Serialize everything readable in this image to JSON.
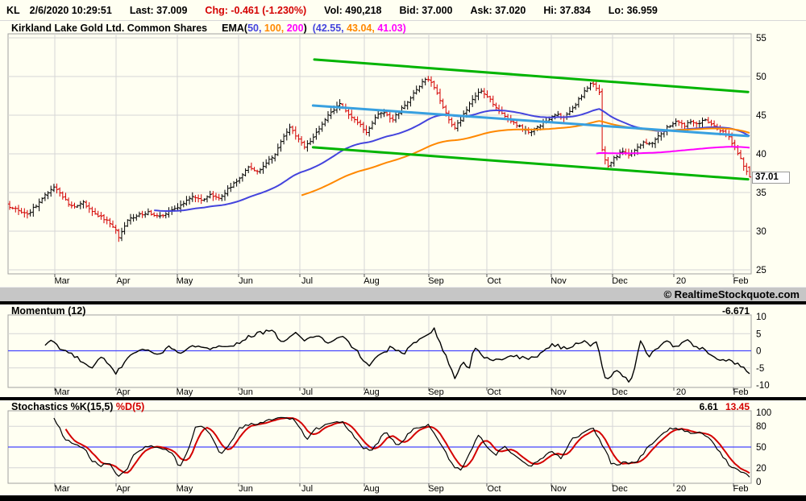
{
  "header": {
    "symbol": "KL",
    "datetime": "2/6/2020 10:29:51",
    "last": "Last: 37.009",
    "chg": "Chg: -0.461 (-1.230%)",
    "vol": "Vol: 490,218",
    "bid": "Bid: 37.000",
    "ask": "Ask: 37.020",
    "hi": "Hi: 37.834",
    "lo": "Lo: 36.959"
  },
  "watermark": "© RealtimeStockquote.com",
  "colors": {
    "up_bar": "#000000",
    "down_bar": "#d40000",
    "ema50": "#4444dd",
    "ema100": "#ff8800",
    "ema200": "#ff00ff",
    "trend_green": "#00b400",
    "trend_cyan": "#38a0e0",
    "mid_blue": "#4444ff",
    "grid": "#d6d6d6",
    "box": "#a0a0a0",
    "bg": "#fffff2"
  },
  "months": [
    {
      "label": "Mar",
      "frac": 0.061
    },
    {
      "label": "Apr",
      "frac": 0.1438
    },
    {
      "label": "May",
      "frac": 0.2266
    },
    {
      "label": "Jun",
      "frac": 0.3094
    },
    {
      "label": "Jul",
      "frac": 0.3922
    },
    {
      "label": "Aug",
      "frac": 0.4793
    },
    {
      "label": "Sep",
      "frac": 0.5664
    },
    {
      "label": "Oct",
      "frac": 0.6449
    },
    {
      "label": "Nov",
      "frac": 0.732
    },
    {
      "label": "Dec",
      "frac": 0.8148
    },
    {
      "label": "20",
      "frac": 0.8976
    },
    {
      "label": "Feb",
      "frac": 0.9782
    }
  ],
  "chart_data": [
    {
      "type": "bar",
      "subtype": "ohlc-daily",
      "title": "Kirkland Lake Gold Ltd. Common Shares",
      "legend": {
        "label": "EMA",
        "periods": [
          "50",
          "100",
          "200"
        ],
        "values": [
          "42.55",
          "43.04",
          "41.03"
        ],
        "colors": [
          "#4444dd",
          "#ff8800",
          "#ff00ff"
        ]
      },
      "ylim": [
        25,
        55
      ],
      "yticks": [
        "55",
        "50",
        "45",
        "40",
        "35",
        "30",
        "25"
      ],
      "last_price_label": "37.01",
      "bars": 252,
      "close_anchors": [
        [
          0.0,
          33.2
        ],
        [
          0.013,
          32.6
        ],
        [
          0.024,
          32.1
        ],
        [
          0.038,
          33.6
        ],
        [
          0.052,
          35.0
        ],
        [
          0.06,
          35.8
        ],
        [
          0.072,
          34.3
        ],
        [
          0.085,
          33.1
        ],
        [
          0.1,
          33.7
        ],
        [
          0.114,
          32.3
        ],
        [
          0.13,
          31.5
        ],
        [
          0.143,
          30.2
        ],
        [
          0.148,
          29.2
        ],
        [
          0.158,
          31.3
        ],
        [
          0.172,
          32.1
        ],
        [
          0.188,
          32.4
        ],
        [
          0.203,
          31.9
        ],
        [
          0.217,
          32.7
        ],
        [
          0.233,
          33.3
        ],
        [
          0.247,
          34.6
        ],
        [
          0.258,
          33.9
        ],
        [
          0.271,
          34.8
        ],
        [
          0.282,
          34.1
        ],
        [
          0.296,
          35.5
        ],
        [
          0.31,
          36.9
        ],
        [
          0.324,
          38.3
        ],
        [
          0.334,
          37.6
        ],
        [
          0.348,
          38.9
        ],
        [
          0.358,
          39.9
        ],
        [
          0.368,
          41.9
        ],
        [
          0.379,
          43.4
        ],
        [
          0.388,
          42.1
        ],
        [
          0.398,
          40.9
        ],
        [
          0.407,
          41.7
        ],
        [
          0.417,
          43.1
        ],
        [
          0.428,
          44.7
        ],
        [
          0.44,
          45.9
        ],
        [
          0.447,
          46.5
        ],
        [
          0.458,
          45.1
        ],
        [
          0.47,
          44.2
        ],
        [
          0.483,
          42.6
        ],
        [
          0.493,
          44.7
        ],
        [
          0.504,
          45.4
        ],
        [
          0.517,
          44.4
        ],
        [
          0.528,
          45.7
        ],
        [
          0.54,
          47.0
        ],
        [
          0.551,
          48.5
        ],
        [
          0.562,
          49.8
        ],
        [
          0.573,
          48.8
        ],
        [
          0.584,
          46.4
        ],
        [
          0.596,
          44.0
        ],
        [
          0.602,
          43.3
        ],
        [
          0.613,
          45.0
        ],
        [
          0.624,
          46.9
        ],
        [
          0.635,
          48.2
        ],
        [
          0.646,
          47.3
        ],
        [
          0.657,
          46.1
        ],
        [
          0.668,
          45.0
        ],
        [
          0.679,
          44.2
        ],
        [
          0.692,
          43.3
        ],
        [
          0.704,
          42.8
        ],
        [
          0.715,
          43.6
        ],
        [
          0.727,
          44.4
        ],
        [
          0.738,
          45.1
        ],
        [
          0.748,
          44.7
        ],
        [
          0.758,
          45.5
        ],
        [
          0.767,
          46.7
        ],
        [
          0.776,
          48.0
        ],
        [
          0.786,
          49.3
        ],
        [
          0.793,
          48.4
        ],
        [
          0.797,
          48.0
        ],
        [
          0.801,
          40.0
        ],
        [
          0.808,
          38.4
        ],
        [
          0.816,
          39.4
        ],
        [
          0.827,
          40.3
        ],
        [
          0.838,
          39.7
        ],
        [
          0.847,
          40.8
        ],
        [
          0.857,
          41.6
        ],
        [
          0.868,
          41.2
        ],
        [
          0.879,
          42.5
        ],
        [
          0.89,
          43.5
        ],
        [
          0.901,
          44.2
        ],
        [
          0.912,
          43.6
        ],
        [
          0.92,
          44.3
        ],
        [
          0.929,
          43.8
        ],
        [
          0.939,
          44.6
        ],
        [
          0.948,
          43.9
        ],
        [
          0.956,
          43.2
        ],
        [
          0.964,
          42.8
        ],
        [
          0.972,
          42.1
        ],
        [
          0.979,
          41.0
        ],
        [
          0.986,
          39.7
        ],
        [
          0.992,
          38.5
        ],
        [
          1.0,
          37.01
        ]
      ],
      "last_bar": {
        "open": 38.25,
        "high": 38.4,
        "low": 36.959,
        "close": 37.009
      },
      "trendlines": [
        {
          "pts": [
            [
              0.4118,
              52.2
            ],
            [
              0.998,
              48.0
            ]
          ],
          "color": "#00b400",
          "width": 3
        },
        {
          "pts": [
            [
              0.41,
              40.85
            ],
            [
              0.998,
              36.7
            ]
          ],
          "color": "#00b400",
          "width": 3
        },
        {
          "pts": [
            [
              0.41,
              46.25
            ],
            [
              0.998,
              42.3
            ]
          ],
          "color": "#38a0e0",
          "width": 3
        }
      ]
    },
    {
      "type": "line",
      "title": "Momentum (12)",
      "last_value": "-6.671",
      "ylim": [
        -10,
        10
      ],
      "yticks": [
        "10",
        "5",
        "0",
        "-5",
        "-10"
      ],
      "zero_line": 0,
      "start_index": 12,
      "anchors": [
        [
          0.041,
          -0.3
        ],
        [
          0.055,
          3.3
        ],
        [
          0.068,
          0.8
        ],
        [
          0.088,
          -1.6
        ],
        [
          0.111,
          -5.4
        ],
        [
          0.124,
          -1.8
        ],
        [
          0.144,
          -6.6
        ],
        [
          0.162,
          -1.2
        ],
        [
          0.178,
          0.6
        ],
        [
          0.198,
          -1.2
        ],
        [
          0.218,
          1.2
        ],
        [
          0.233,
          -0.9
        ],
        [
          0.25,
          1.6
        ],
        [
          0.266,
          0.2
        ],
        [
          0.283,
          1.9
        ],
        [
          0.3,
          1.0
        ],
        [
          0.318,
          3.7
        ],
        [
          0.335,
          5.0
        ],
        [
          0.354,
          5.8
        ],
        [
          0.37,
          2.4
        ],
        [
          0.384,
          5.2
        ],
        [
          0.4,
          3.1
        ],
        [
          0.415,
          4.6
        ],
        [
          0.431,
          2.0
        ],
        [
          0.449,
          4.2
        ],
        [
          0.465,
          1.0
        ],
        [
          0.484,
          -4.4
        ],
        [
          0.5,
          -1.5
        ],
        [
          0.515,
          1.1
        ],
        [
          0.531,
          -1.1
        ],
        [
          0.553,
          3.4
        ],
        [
          0.574,
          6.5
        ],
        [
          0.59,
          -2.0
        ],
        [
          0.602,
          -8.0
        ],
        [
          0.613,
          -3.1
        ],
        [
          0.621,
          -5.2
        ],
        [
          0.627,
          0.9
        ],
        [
          0.641,
          -1.6
        ],
        [
          0.66,
          -2.9
        ],
        [
          0.68,
          -1.2
        ],
        [
          0.7,
          -2.6
        ],
        [
          0.716,
          -1.0
        ],
        [
          0.734,
          2.0
        ],
        [
          0.751,
          0.5
        ],
        [
          0.777,
          3.2
        ],
        [
          0.786,
          1.5
        ],
        [
          0.793,
          3.0
        ],
        [
          0.804,
          -8.2
        ],
        [
          0.823,
          -5.9
        ],
        [
          0.839,
          -9.7
        ],
        [
          0.853,
          3.1
        ],
        [
          0.864,
          -1.7
        ],
        [
          0.885,
          3.1
        ],
        [
          0.9,
          1.0
        ],
        [
          0.915,
          3.0
        ],
        [
          0.927,
          1.2
        ],
        [
          0.939,
          0.5
        ],
        [
          0.955,
          -2.4
        ],
        [
          0.974,
          -2.9
        ],
        [
          0.99,
          -4.8
        ],
        [
          1.0,
          -6.671
        ]
      ]
    },
    {
      "type": "line",
      "title_k": "Stochastics %K(15,5) ",
      "title_d": "%D(5)",
      "last_k": "6.61",
      "last_d": "13.45",
      "ylim": [
        0,
        100
      ],
      "yticks": [
        "100",
        "80",
        "50",
        "20",
        "0"
      ],
      "mid_line": 50,
      "start_index_k": 15,
      "start_index_d": 19,
      "d_is": "5-period moving average of %K",
      "k_anchors": [
        [
          0.061,
          91
        ],
        [
          0.074,
          62
        ],
        [
          0.088,
          55
        ],
        [
          0.1,
          50
        ],
        [
          0.112,
          30
        ],
        [
          0.123,
          22
        ],
        [
          0.134,
          27
        ],
        [
          0.148,
          6
        ],
        [
          0.159,
          20
        ],
        [
          0.168,
          38
        ],
        [
          0.181,
          50
        ],
        [
          0.196,
          51
        ],
        [
          0.21,
          46
        ],
        [
          0.222,
          38
        ],
        [
          0.23,
          19
        ],
        [
          0.243,
          52
        ],
        [
          0.252,
          81
        ],
        [
          0.266,
          76
        ],
        [
          0.276,
          60
        ],
        [
          0.285,
          36
        ],
        [
          0.297,
          56
        ],
        [
          0.312,
          78
        ],
        [
          0.326,
          82
        ],
        [
          0.341,
          86
        ],
        [
          0.357,
          90
        ],
        [
          0.381,
          92
        ],
        [
          0.402,
          62
        ],
        [
          0.414,
          76
        ],
        [
          0.448,
          88
        ],
        [
          0.479,
          48
        ],
        [
          0.489,
          45
        ],
        [
          0.508,
          72
        ],
        [
          0.525,
          52
        ],
        [
          0.545,
          75
        ],
        [
          0.565,
          82
        ],
        [
          0.583,
          55
        ],
        [
          0.599,
          22
        ],
        [
          0.612,
          18
        ],
        [
          0.634,
          68
        ],
        [
          0.655,
          38
        ],
        [
          0.668,
          50
        ],
        [
          0.68,
          40
        ],
        [
          0.705,
          22
        ],
        [
          0.733,
          45
        ],
        [
          0.745,
          35
        ],
        [
          0.761,
          62
        ],
        [
          0.789,
          78
        ],
        [
          0.814,
          25
        ],
        [
          0.833,
          28
        ],
        [
          0.845,
          26
        ],
        [
          0.867,
          55
        ],
        [
          0.894,
          78
        ],
        [
          0.909,
          76
        ],
        [
          0.922,
          68
        ],
        [
          0.932,
          74
        ],
        [
          0.948,
          60
        ],
        [
          0.957,
          45
        ],
        [
          0.972,
          25
        ],
        [
          0.986,
          15
        ],
        [
          1.0,
          6.61
        ]
      ]
    }
  ]
}
